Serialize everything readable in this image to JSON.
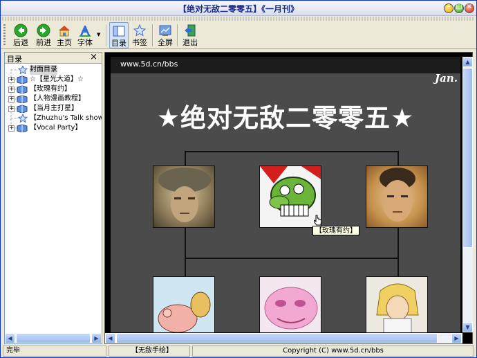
{
  "window": {
    "title": "【绝对无敌二零零五】《一月刊》"
  },
  "toolbar": {
    "back": "后退",
    "forward": "前进",
    "home": "主页",
    "font": "字体",
    "toc": "目录",
    "bookmark": "书签",
    "fullscreen": "全屏",
    "exit": "退出"
  },
  "sidebar": {
    "header": "目录",
    "close": "×",
    "items": [
      {
        "label": "封面目录",
        "expandable": false
      },
      {
        "label": "☆【星光大道】☆",
        "expandable": true
      },
      {
        "label": "【玫瑰有约】",
        "expandable": true
      },
      {
        "label": "【人物漫画教程】",
        "expandable": true
      },
      {
        "label": "【当月主打星】",
        "expandable": true
      },
      {
        "label": "【Zhuzhu's Talk show】",
        "expandable": false
      },
      {
        "label": "【Vocal Party】",
        "expandable": true
      }
    ]
  },
  "content": {
    "url": "www.5d.cn/bbs",
    "issue_tag": "Jan.",
    "headline": "★绝对无敌二零零五★",
    "tooltip": "【玫瑰有约】"
  },
  "status": {
    "left": "完毕",
    "middle": "【无敌手绘】",
    "right": "Copyright (C) www.5d.cn/bbs"
  },
  "colors": {
    "accent": "#0831d9",
    "page_bg": "#4b4b4b",
    "chrome": "#ece9d8"
  }
}
